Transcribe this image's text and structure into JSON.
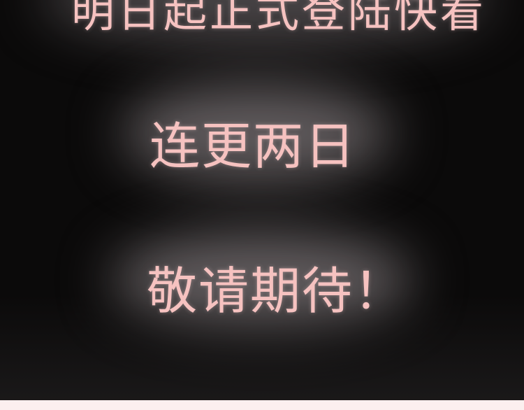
{
  "panel": {
    "lines": [
      "明日起正式登陆快看",
      "连更两日",
      "敬请期待！"
    ]
  },
  "colors": {
    "background": "#0b0a0a",
    "text": "#f6c2c0",
    "footer_strip": "#fcefef"
  }
}
